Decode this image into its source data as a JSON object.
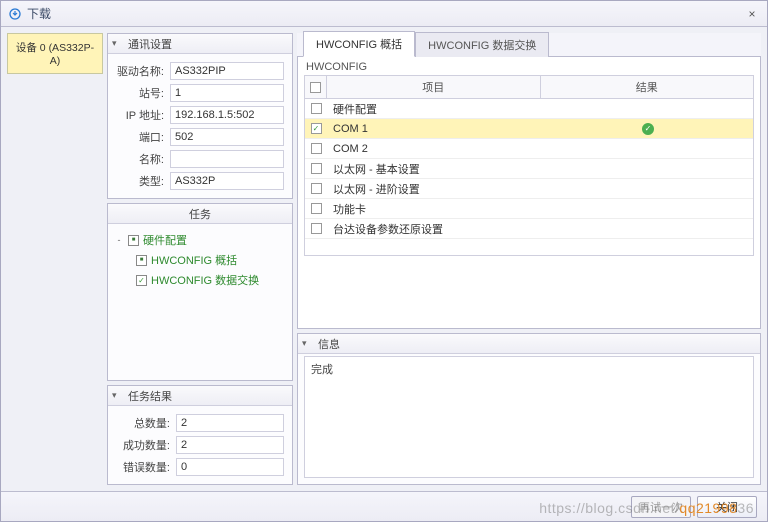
{
  "title": "下载",
  "device_label": "设备 0 (AS332P-A)",
  "comm_settings": {
    "header": "通讯设置",
    "rows": {
      "driver_name_label": "驱动名称:",
      "driver_name": "AS332PIP",
      "station_label": "站号:",
      "station": "1",
      "ip_label": "IP 地址:",
      "ip": "192.168.1.5:502",
      "port_label": "端口:",
      "port": "502",
      "name_label": "名称:",
      "name": "",
      "type_label": "类型:",
      "type": "AS332P"
    }
  },
  "tasks": {
    "header": "任务",
    "root": "硬件配置",
    "children": [
      "HWCONFIG 概括",
      "HWCONFIG 数据交换"
    ]
  },
  "results": {
    "header": "任务结果",
    "total_label": "总数量:",
    "total": "2",
    "success_label": "成功数量:",
    "success": "2",
    "error_label": "错误数量:",
    "error": "0"
  },
  "tabs": [
    "HWCONFIG 概括",
    "HWCONFIG 数据交换"
  ],
  "grid": {
    "group_label": "HWCONFIG",
    "col_item": "项目",
    "col_result": "结果",
    "rows": [
      {
        "label": "硬件配置",
        "checked": false,
        "selected": false,
        "ok": false
      },
      {
        "label": "COM 1",
        "checked": true,
        "selected": true,
        "ok": true
      },
      {
        "label": "COM 2",
        "checked": false,
        "selected": false,
        "ok": false
      },
      {
        "label": "以太网 - 基本设置",
        "checked": false,
        "selected": false,
        "ok": false
      },
      {
        "label": "以太网 - 进阶设置",
        "checked": false,
        "selected": false,
        "ok": false
      },
      {
        "label": "功能卡",
        "checked": false,
        "selected": false,
        "ok": false
      },
      {
        "label": "台达设备参数还原设置",
        "checked": false,
        "selected": false,
        "ok": false
      }
    ]
  },
  "info": {
    "header": "信息",
    "content": "完成"
  },
  "footer": {
    "retry": "再试一次",
    "close": "关闭"
  },
  "watermark_a": "https://blog.csdn.net/",
  "watermark_b": "qq21998",
  "watermark_c": "36"
}
